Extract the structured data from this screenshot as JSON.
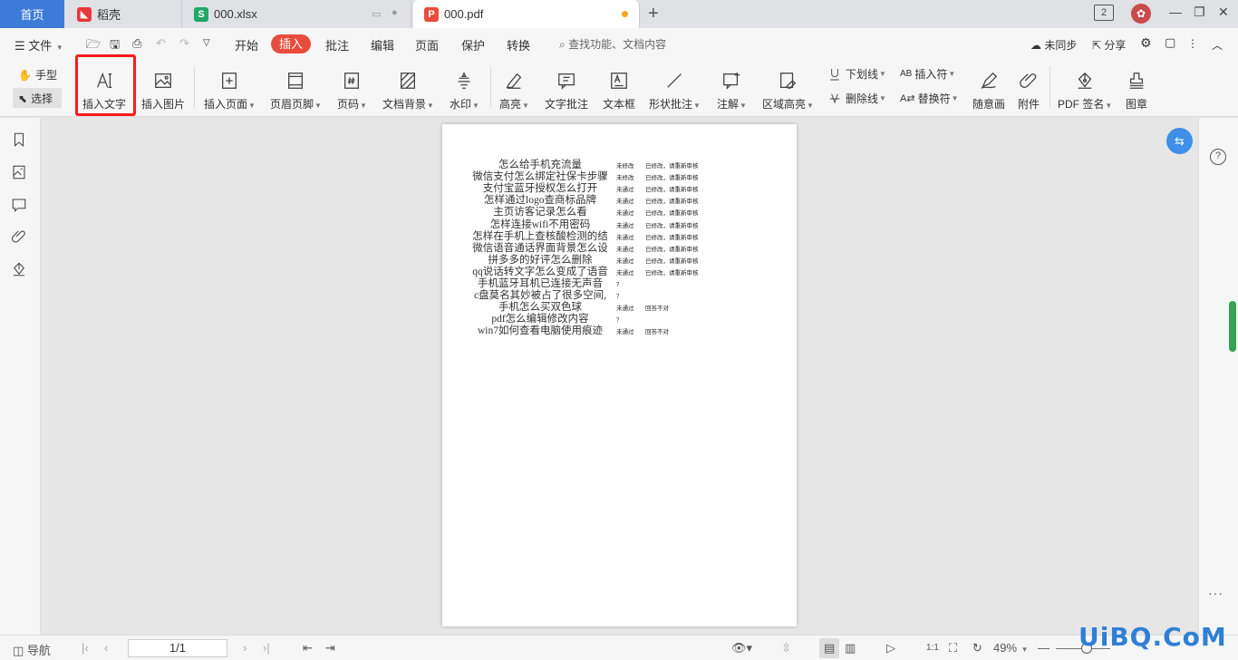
{
  "tabs": {
    "home": "首页",
    "daoke": "稻壳",
    "xlsx": "000.xlsx",
    "pdf": "000.pdf",
    "window_badge": "2"
  },
  "menu": {
    "file": "文件",
    "items": [
      "开始",
      "插入",
      "批注",
      "编辑",
      "页面",
      "保护",
      "转换"
    ],
    "active": "插入",
    "search_placeholder": "查找功能、文档内容",
    "sync": "未同步",
    "share": "分享"
  },
  "ribbon": {
    "hand": "手型",
    "select": "选择",
    "insert_text": "插入文字",
    "insert_image": "插入图片",
    "insert_page": "插入页面",
    "header_footer": "页眉页脚",
    "page_number": "页码",
    "doc_background": "文档背景",
    "watermark": "水印",
    "highlight": "高亮",
    "text_comment": "文字批注",
    "text_box": "文本框",
    "shape_comment": "形状批注",
    "annotation": "注解",
    "area_highlight": "区域高亮",
    "underline": "下划线",
    "strikethrough": "删除线",
    "insert_symbol": "插入符",
    "replace_symbol": "替换符",
    "freehand": "随意画",
    "attachment": "附件",
    "pdf_sign": "PDF 签名",
    "stamp": "图章"
  },
  "document": {
    "rows": [
      {
        "q": "怎么给手机充流量",
        "s1": "未修改",
        "s2": "已修改，请重新审核"
      },
      {
        "q": "微信支付怎么绑定社保卡步骤",
        "s1": "未修改",
        "s2": "已修改，请重新审核"
      },
      {
        "q": "支付宝蓝牙授权怎么打开",
        "s1": "未通过",
        "s2": "已修改，请重新审核"
      },
      {
        "q": "怎样通过logo查商标品牌",
        "s1": "未通过",
        "s2": "已修改，请重新审核"
      },
      {
        "q": "主页访客记录怎么看",
        "s1": "未通过",
        "s2": "已修改，请重新审核"
      },
      {
        "q": "怎样连接wifi不用密码",
        "s1": "未通过",
        "s2": "已修改，请重新审核"
      },
      {
        "q": "怎样在手机上查核酸检测的结",
        "s1": "未通过",
        "s2": "已修改，请重新审核"
      },
      {
        "q": "微信语音通话界面背景怎么设",
        "s1": "未通过",
        "s2": "已修改，请重新审核"
      },
      {
        "q": "拼多多的好评怎么删除",
        "s1": "未通过",
        "s2": "已修改，请重新审核"
      },
      {
        "q": "qq说话转文字怎么变成了语音",
        "s1": "未通过",
        "s2": "已修改，请重新审核"
      },
      {
        "q": "手机蓝牙耳机已连接无声音",
        "s1": "？",
        "s2": ""
      },
      {
        "q": "c盘莫名其妙被占了很多空间,",
        "s1": "？",
        "s2": ""
      },
      {
        "q": "手机怎么买双色球",
        "s1": "未通过",
        "s2": "回答不对"
      },
      {
        "q": "pdf怎么编辑修改内容",
        "s1": "？",
        "s2": ""
      },
      {
        "q": "win7如何查看电脑使用痕迹",
        "s1": "未通过",
        "s2": "回答不对"
      }
    ]
  },
  "statusbar": {
    "nav": "导航",
    "page": "1/1",
    "zoom": "49%"
  },
  "watermark_text": "UiBQ.CoM",
  "colors": {
    "home_tab": "#3d7bd9",
    "active_menu": "#e84c3d",
    "highlight_border": "#ff1a1a",
    "scroll_thumb": "#37a254"
  }
}
